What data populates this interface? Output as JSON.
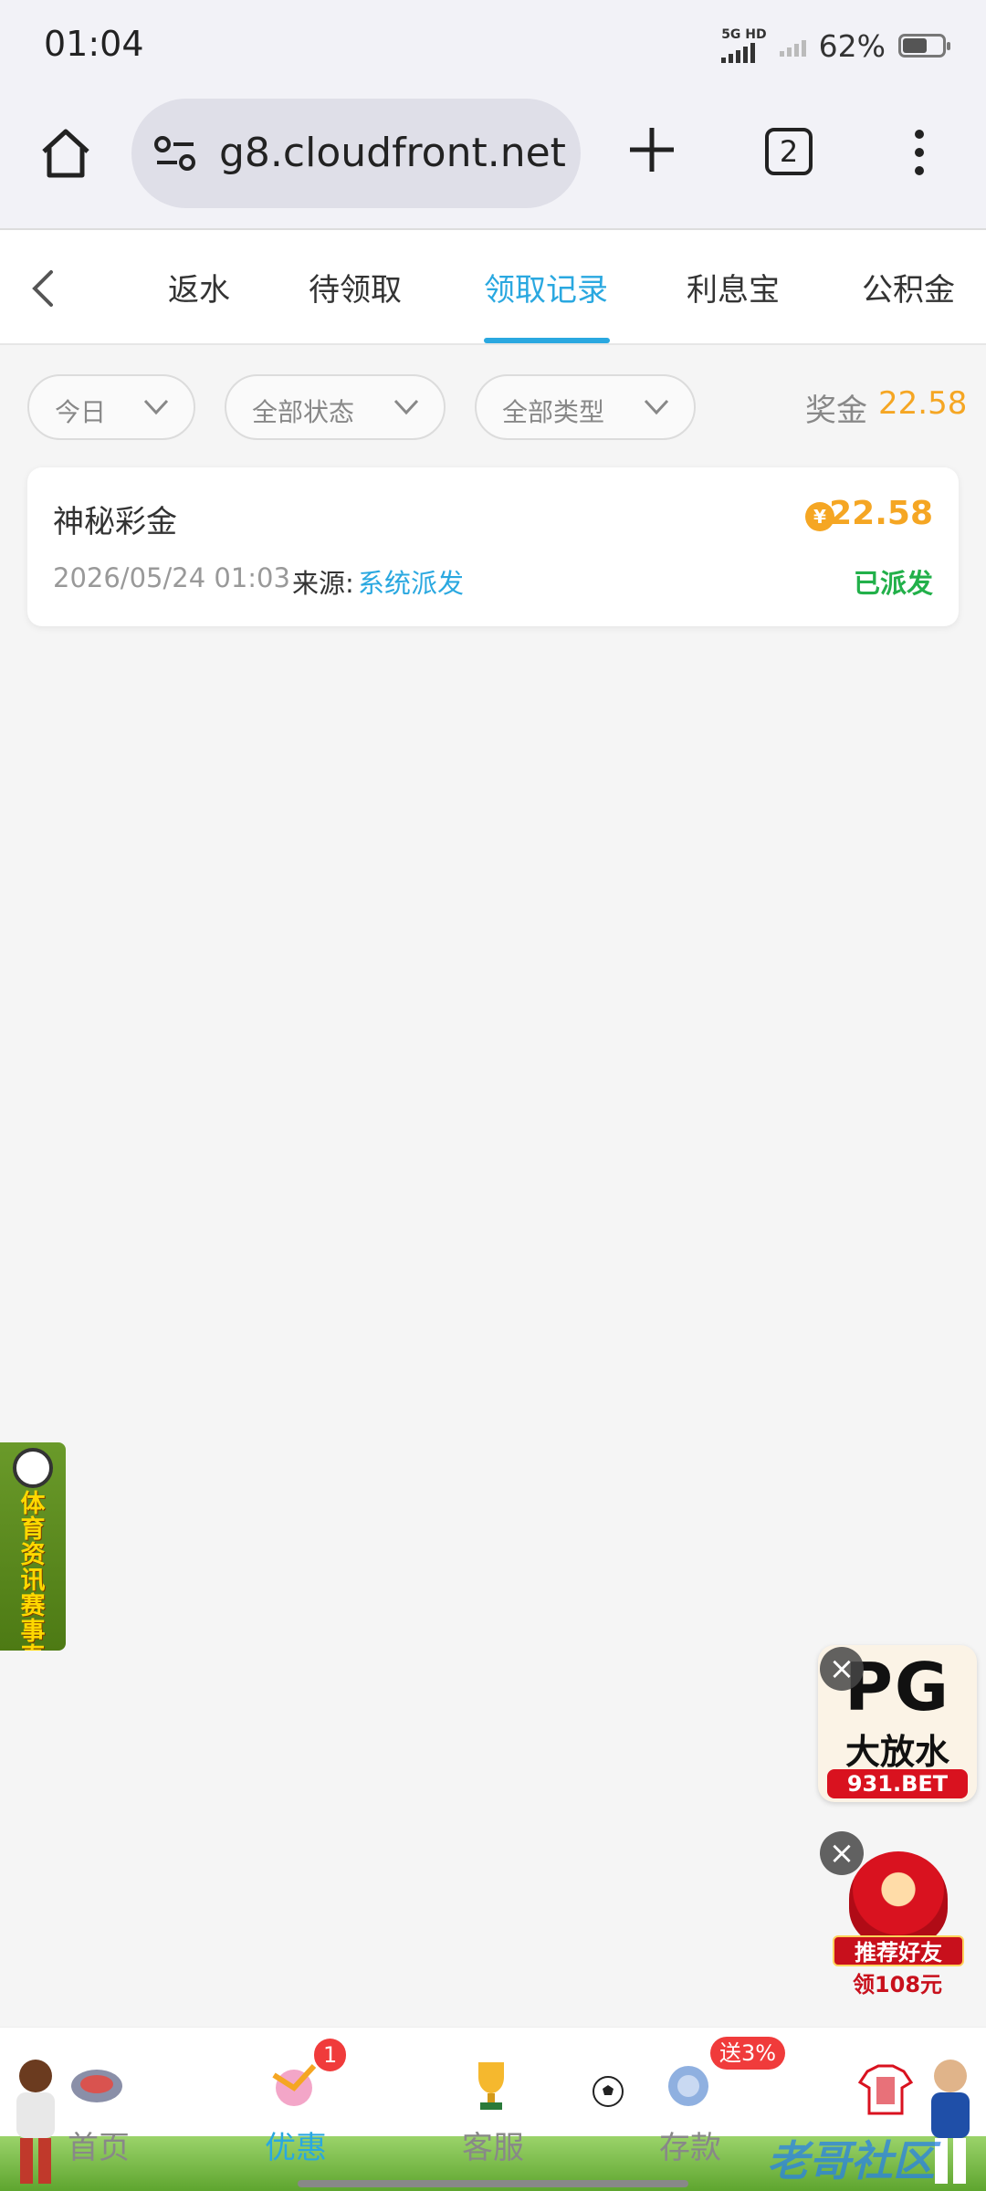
{
  "status_bar": {
    "time": "01:04",
    "network_label_top": "5G HD",
    "battery_percent": "62%",
    "battery_level": 0.62
  },
  "browser": {
    "url": "g8.cloudfront.net",
    "tab_count": "2"
  },
  "tabs": [
    {
      "label": "返水",
      "active": false
    },
    {
      "label": "待领取",
      "active": false
    },
    {
      "label": "领取记录",
      "active": true
    },
    {
      "label": "利息宝",
      "active": false
    },
    {
      "label": "公积金",
      "active": false
    }
  ],
  "filters": {
    "date": "今日",
    "status": "全部状态",
    "type": "全部类型"
  },
  "bonus": {
    "label": "奖金",
    "value": "22.58"
  },
  "records": [
    {
      "title": "神秘彩金",
      "currency_symbol": "¥",
      "amount": "22.58",
      "datetime": "2026/05/24 01:03",
      "source_label": "来源:",
      "source_value": "系统派发",
      "status": "已派发"
    }
  ],
  "side_banner": {
    "text": "体育资讯赛事直播"
  },
  "ads": {
    "pg_title": "PG",
    "pg_subtitle": "大放水",
    "pg_site": "931.BET",
    "friend_text": "推荐好友",
    "friend_reward": "领108元"
  },
  "bottom_nav": {
    "items": [
      {
        "label": "首页",
        "active": false
      },
      {
        "label": "优惠",
        "active": true,
        "badge": "1"
      },
      {
        "label": "客服",
        "active": false
      },
      {
        "label": "存款",
        "active": false,
        "badge": "送3%"
      }
    ]
  },
  "watermark": "老哥社区",
  "colors": {
    "accent": "#2aa8e0",
    "amount": "#f5a623",
    "status_ok": "#22b04a",
    "badge": "#f03b3b"
  }
}
